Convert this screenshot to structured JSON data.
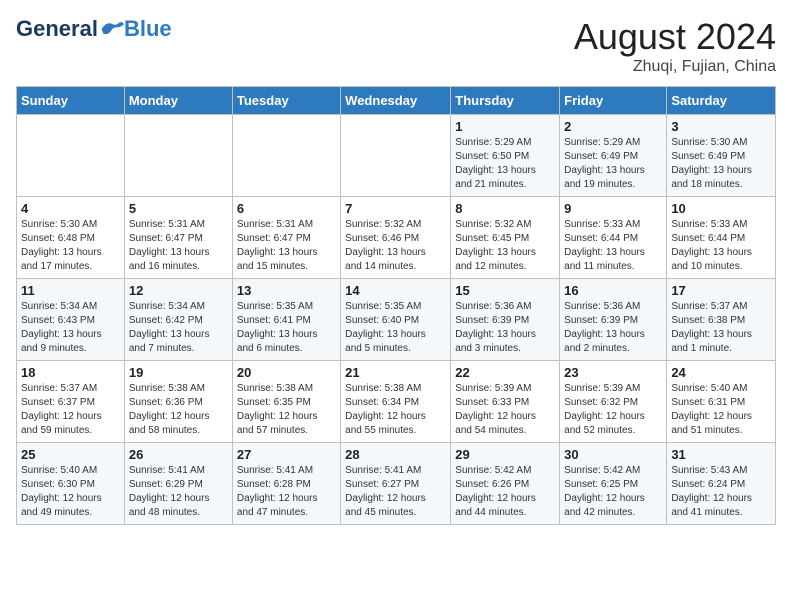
{
  "header": {
    "logo": {
      "general": "General",
      "blue": "Blue"
    },
    "title": "August 2024",
    "location": "Zhuqi, Fujian, China"
  },
  "weekdays": [
    "Sunday",
    "Monday",
    "Tuesday",
    "Wednesday",
    "Thursday",
    "Friday",
    "Saturday"
  ],
  "weeks": [
    [
      {
        "day": "",
        "info": ""
      },
      {
        "day": "",
        "info": ""
      },
      {
        "day": "",
        "info": ""
      },
      {
        "day": "",
        "info": ""
      },
      {
        "day": "1",
        "info": "Sunrise: 5:29 AM\nSunset: 6:50 PM\nDaylight: 13 hours\nand 21 minutes."
      },
      {
        "day": "2",
        "info": "Sunrise: 5:29 AM\nSunset: 6:49 PM\nDaylight: 13 hours\nand 19 minutes."
      },
      {
        "day": "3",
        "info": "Sunrise: 5:30 AM\nSunset: 6:49 PM\nDaylight: 13 hours\nand 18 minutes."
      }
    ],
    [
      {
        "day": "4",
        "info": "Sunrise: 5:30 AM\nSunset: 6:48 PM\nDaylight: 13 hours\nand 17 minutes."
      },
      {
        "day": "5",
        "info": "Sunrise: 5:31 AM\nSunset: 6:47 PM\nDaylight: 13 hours\nand 16 minutes."
      },
      {
        "day": "6",
        "info": "Sunrise: 5:31 AM\nSunset: 6:47 PM\nDaylight: 13 hours\nand 15 minutes."
      },
      {
        "day": "7",
        "info": "Sunrise: 5:32 AM\nSunset: 6:46 PM\nDaylight: 13 hours\nand 14 minutes."
      },
      {
        "day": "8",
        "info": "Sunrise: 5:32 AM\nSunset: 6:45 PM\nDaylight: 13 hours\nand 12 minutes."
      },
      {
        "day": "9",
        "info": "Sunrise: 5:33 AM\nSunset: 6:44 PM\nDaylight: 13 hours\nand 11 minutes."
      },
      {
        "day": "10",
        "info": "Sunrise: 5:33 AM\nSunset: 6:44 PM\nDaylight: 13 hours\nand 10 minutes."
      }
    ],
    [
      {
        "day": "11",
        "info": "Sunrise: 5:34 AM\nSunset: 6:43 PM\nDaylight: 13 hours\nand 9 minutes."
      },
      {
        "day": "12",
        "info": "Sunrise: 5:34 AM\nSunset: 6:42 PM\nDaylight: 13 hours\nand 7 minutes."
      },
      {
        "day": "13",
        "info": "Sunrise: 5:35 AM\nSunset: 6:41 PM\nDaylight: 13 hours\nand 6 minutes."
      },
      {
        "day": "14",
        "info": "Sunrise: 5:35 AM\nSunset: 6:40 PM\nDaylight: 13 hours\nand 5 minutes."
      },
      {
        "day": "15",
        "info": "Sunrise: 5:36 AM\nSunset: 6:39 PM\nDaylight: 13 hours\nand 3 minutes."
      },
      {
        "day": "16",
        "info": "Sunrise: 5:36 AM\nSunset: 6:39 PM\nDaylight: 13 hours\nand 2 minutes."
      },
      {
        "day": "17",
        "info": "Sunrise: 5:37 AM\nSunset: 6:38 PM\nDaylight: 13 hours\nand 1 minute."
      }
    ],
    [
      {
        "day": "18",
        "info": "Sunrise: 5:37 AM\nSunset: 6:37 PM\nDaylight: 12 hours\nand 59 minutes."
      },
      {
        "day": "19",
        "info": "Sunrise: 5:38 AM\nSunset: 6:36 PM\nDaylight: 12 hours\nand 58 minutes."
      },
      {
        "day": "20",
        "info": "Sunrise: 5:38 AM\nSunset: 6:35 PM\nDaylight: 12 hours\nand 57 minutes."
      },
      {
        "day": "21",
        "info": "Sunrise: 5:38 AM\nSunset: 6:34 PM\nDaylight: 12 hours\nand 55 minutes."
      },
      {
        "day": "22",
        "info": "Sunrise: 5:39 AM\nSunset: 6:33 PM\nDaylight: 12 hours\nand 54 minutes."
      },
      {
        "day": "23",
        "info": "Sunrise: 5:39 AM\nSunset: 6:32 PM\nDaylight: 12 hours\nand 52 minutes."
      },
      {
        "day": "24",
        "info": "Sunrise: 5:40 AM\nSunset: 6:31 PM\nDaylight: 12 hours\nand 51 minutes."
      }
    ],
    [
      {
        "day": "25",
        "info": "Sunrise: 5:40 AM\nSunset: 6:30 PM\nDaylight: 12 hours\nand 49 minutes."
      },
      {
        "day": "26",
        "info": "Sunrise: 5:41 AM\nSunset: 6:29 PM\nDaylight: 12 hours\nand 48 minutes."
      },
      {
        "day": "27",
        "info": "Sunrise: 5:41 AM\nSunset: 6:28 PM\nDaylight: 12 hours\nand 47 minutes."
      },
      {
        "day": "28",
        "info": "Sunrise: 5:41 AM\nSunset: 6:27 PM\nDaylight: 12 hours\nand 45 minutes."
      },
      {
        "day": "29",
        "info": "Sunrise: 5:42 AM\nSunset: 6:26 PM\nDaylight: 12 hours\nand 44 minutes."
      },
      {
        "day": "30",
        "info": "Sunrise: 5:42 AM\nSunset: 6:25 PM\nDaylight: 12 hours\nand 42 minutes."
      },
      {
        "day": "31",
        "info": "Sunrise: 5:43 AM\nSunset: 6:24 PM\nDaylight: 12 hours\nand 41 minutes."
      }
    ]
  ]
}
